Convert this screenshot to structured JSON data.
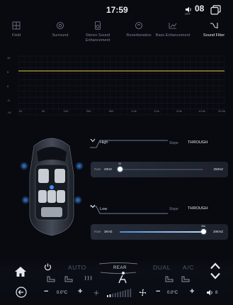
{
  "status_bar": {
    "time": "17:59",
    "volume_icon": "speaker-icon",
    "volume_sublabel": "OFF",
    "volume_value": "08",
    "window_icon": "window-icon"
  },
  "tabs": [
    {
      "label": "Field",
      "icon": "field-icon",
      "active": false
    },
    {
      "label": "Surround",
      "icon": "surround-icon",
      "active": false
    },
    {
      "label": "Stereo Sound Enhancement",
      "icon": "stereo-icon",
      "active": false
    },
    {
      "label": "Reverberation",
      "icon": "reverb-icon",
      "active": false
    },
    {
      "label": "Bass Enhancement",
      "icon": "bass-icon",
      "active": false
    },
    {
      "label": "Sound Filter",
      "icon": "filter-icon",
      "active": true
    }
  ],
  "eq_graph": {
    "y_ticks": [
      "10",
      "5",
      "0",
      "-5",
      "-10"
    ],
    "x_ticks": [
      "20",
      "40",
      "100",
      "200",
      "500",
      "1.0k",
      "2.0k",
      "5.0k",
      "10.0k",
      "20.0k"
    ],
    "accent": "#f0c83c"
  },
  "high_filter": {
    "title": "High",
    "slope_label": "Slope",
    "slope_value": "THROUGH",
    "rate_label": "Rate",
    "min_label": "20HZ",
    "max_label": "250HZ",
    "knob_label": "20",
    "fraction": 0.0
  },
  "low_filter": {
    "title": "Low",
    "slope_label": "Slope",
    "slope_value": "THROUGH",
    "rate_label": "Rate",
    "min_label": "3KHZ",
    "max_label": "20KHZ",
    "knob_label": "20k",
    "fraction": 1.0
  },
  "climate": {
    "auto_label": "AUTO",
    "rear_label": "REAR",
    "dual_label": "DUAL",
    "ac_label": "A/C",
    "left_temp": "0.0°C",
    "right_temp": "0.0°C",
    "minus": "−",
    "plus": "+",
    "fan_level": "8",
    "fan_speed_fraction": 0.2
  }
}
